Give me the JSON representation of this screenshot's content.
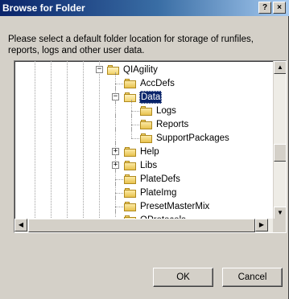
{
  "window": {
    "title": "Browse for Folder",
    "help_glyph": "?",
    "close_glyph": "×"
  },
  "instruction": "Please select a default folder location for storage of runfiles, reports, logs and other user data.",
  "tree": {
    "items": [
      {
        "label": "QIAgility",
        "expander": "−",
        "open": true
      },
      {
        "label": "AccDefs",
        "expander": "",
        "open": false
      },
      {
        "label": "Data",
        "expander": "−",
        "open": true,
        "selected": true
      },
      {
        "label": "Logs",
        "expander": "",
        "open": false
      },
      {
        "label": "Reports",
        "expander": "",
        "open": false
      },
      {
        "label": "SupportPackages",
        "expander": "",
        "open": false
      },
      {
        "label": "Help",
        "expander": "+",
        "open": false
      },
      {
        "label": "Libs",
        "expander": "+",
        "open": false
      },
      {
        "label": "PlateDefs",
        "expander": "",
        "open": false
      },
      {
        "label": "PlateImg",
        "expander": "",
        "open": false
      },
      {
        "label": "PresetMasterMix",
        "expander": "",
        "open": false
      },
      {
        "label": "QProtocols",
        "expander": "",
        "open": false
      }
    ]
  },
  "scrollbar": {
    "up_glyph": "▲",
    "down_glyph": "▼",
    "left_glyph": "◀",
    "right_glyph": "▶"
  },
  "buttons": {
    "ok": "OK",
    "cancel": "Cancel"
  }
}
